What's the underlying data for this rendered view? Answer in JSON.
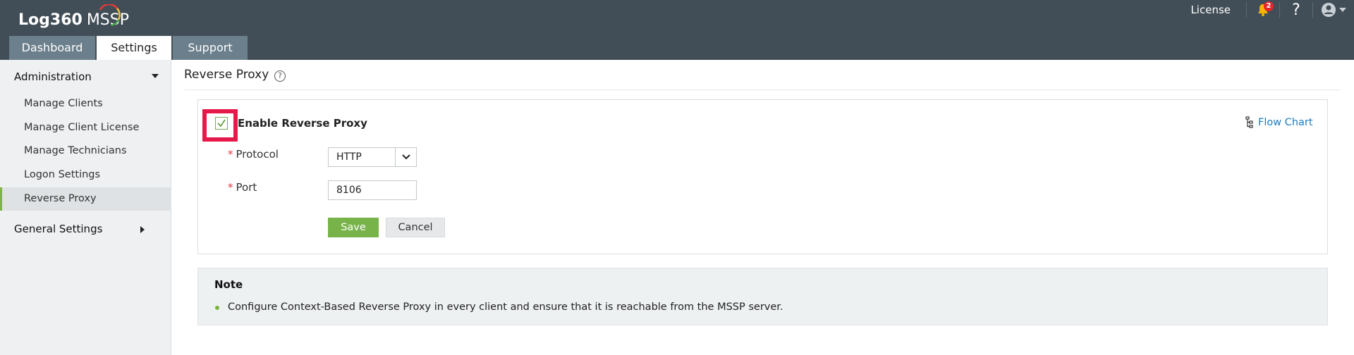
{
  "app": {
    "logo_main": "Log360",
    "logo_sub": "MSSP",
    "tabs": [
      {
        "label": "Dashboard"
      },
      {
        "label": "Settings"
      },
      {
        "label": "Support"
      }
    ],
    "license_label": "License",
    "notification_count": "2",
    "help_label": "?",
    "colors": {
      "topbar": "#424e57",
      "tab_inactive": "#6b7f8c",
      "accent_green": "#78b34a",
      "highlight": "#e6194b",
      "link": "#1a7bbf"
    }
  },
  "sidebar": {
    "admin_label": "Administration",
    "items": [
      {
        "label": "Manage Clients"
      },
      {
        "label": "Manage Client License"
      },
      {
        "label": "Manage Technicians"
      },
      {
        "label": "Logon Settings"
      },
      {
        "label": "Reverse Proxy"
      }
    ],
    "general_label": "General Settings"
  },
  "main": {
    "title": "Reverse Proxy",
    "enable_label": "Enable Reverse Proxy",
    "enable_checked": true,
    "flow_chart_label": "Flow Chart",
    "protocol_label": "Protocol",
    "protocol_value": "HTTP",
    "port_label": "Port",
    "port_value": "8106",
    "save_label": "Save",
    "cancel_label": "Cancel"
  },
  "note": {
    "title": "Note",
    "text": "Configure Context-Based Reverse Proxy in every client and ensure that it is reachable from the MSSP server."
  }
}
